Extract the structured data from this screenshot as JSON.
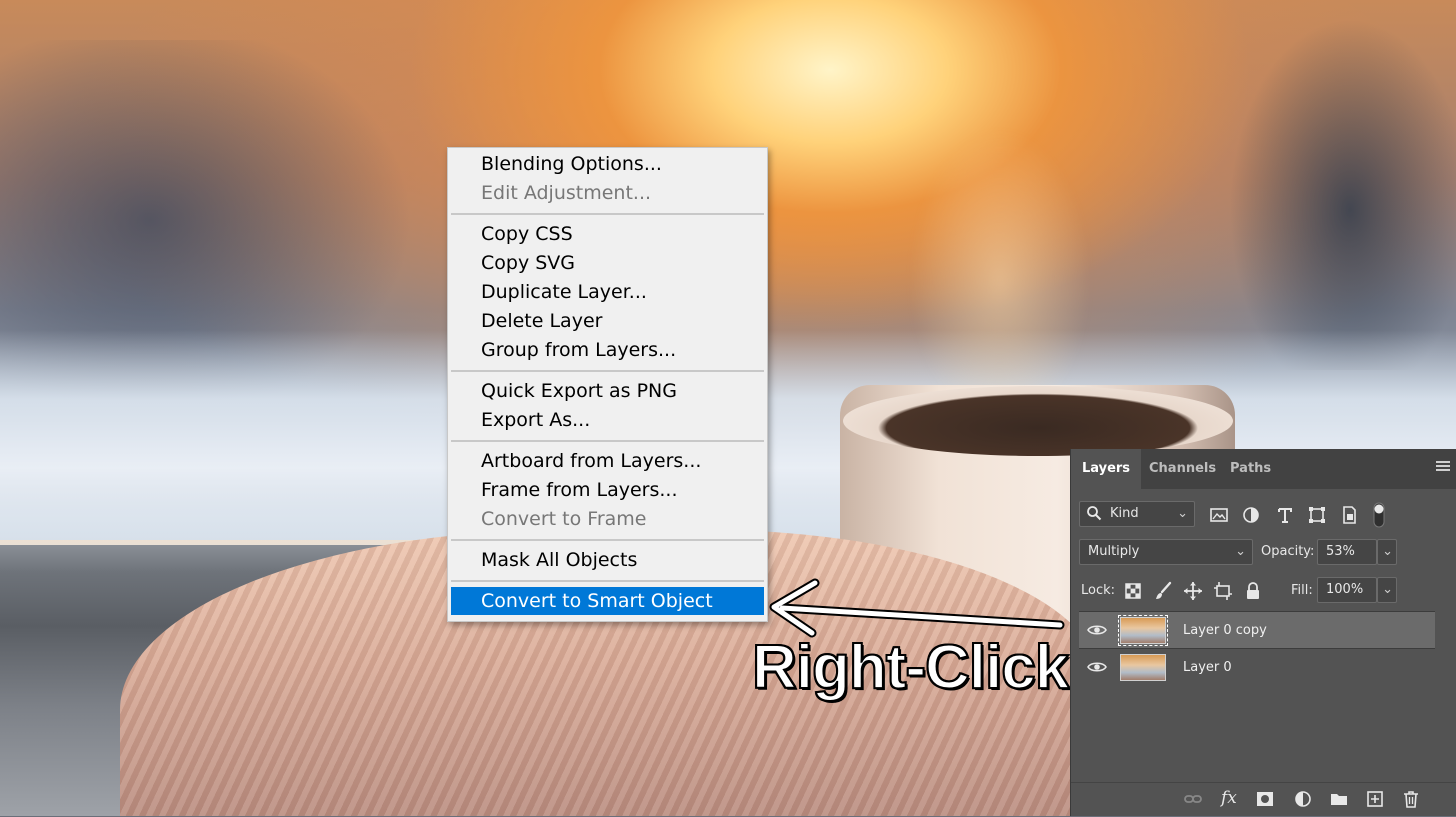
{
  "context_menu": {
    "groups": [
      [
        {
          "label": "Blending Options...",
          "state": "enabled"
        },
        {
          "label": "Edit Adjustment...",
          "state": "disabled"
        }
      ],
      [
        {
          "label": "Copy CSS",
          "state": "enabled"
        },
        {
          "label": "Copy SVG",
          "state": "enabled"
        },
        {
          "label": "Duplicate Layer...",
          "state": "enabled"
        },
        {
          "label": "Delete Layer",
          "state": "enabled"
        },
        {
          "label": "Group from Layers...",
          "state": "enabled"
        }
      ],
      [
        {
          "label": "Quick Export as PNG",
          "state": "enabled"
        },
        {
          "label": "Export As...",
          "state": "enabled"
        }
      ],
      [
        {
          "label": "Artboard from Layers...",
          "state": "enabled"
        },
        {
          "label": "Frame from Layers...",
          "state": "enabled"
        },
        {
          "label": "Convert to Frame",
          "state": "disabled"
        }
      ],
      [
        {
          "label": "Mask All Objects",
          "state": "enabled"
        }
      ],
      [
        {
          "label": "Convert to Smart Object",
          "state": "highlighted"
        }
      ]
    ],
    "highlight_color": "#0078d7"
  },
  "annotation": {
    "text": "Right-Click",
    "arrow_icon": "arrow-left-icon"
  },
  "layers_panel": {
    "tabs": [
      "Layers",
      "Channels",
      "Paths"
    ],
    "active_tab": "Layers",
    "filter": {
      "label": "Kind",
      "icon": "search-icon"
    },
    "filter_icons": [
      "image-filter-icon",
      "adjustment-filter-icon",
      "type-filter-icon",
      "shape-filter-icon",
      "smart-object-filter-icon",
      "filter-toggle-icon"
    ],
    "blend_mode": "Multiply",
    "opacity_label": "Opacity:",
    "opacity_value": "53%",
    "lock_label": "Lock:",
    "lock_icons": [
      "lock-transparent-pixels-icon",
      "lock-image-pixels-icon",
      "lock-position-icon",
      "lock-artboard-icon",
      "lock-all-icon"
    ],
    "fill_label": "Fill:",
    "fill_value": "100%",
    "layers": [
      {
        "name": "Layer 0 copy",
        "selected": true,
        "visible": true
      },
      {
        "name": "Layer 0",
        "selected": false,
        "visible": true
      }
    ],
    "bottom_icons": [
      "link-layers-icon",
      "fx-icon",
      "add-mask-icon",
      "adjustment-layer-icon",
      "group-folder-icon",
      "new-layer-icon",
      "trash-icon"
    ],
    "bottom_fx_label": "fx"
  }
}
